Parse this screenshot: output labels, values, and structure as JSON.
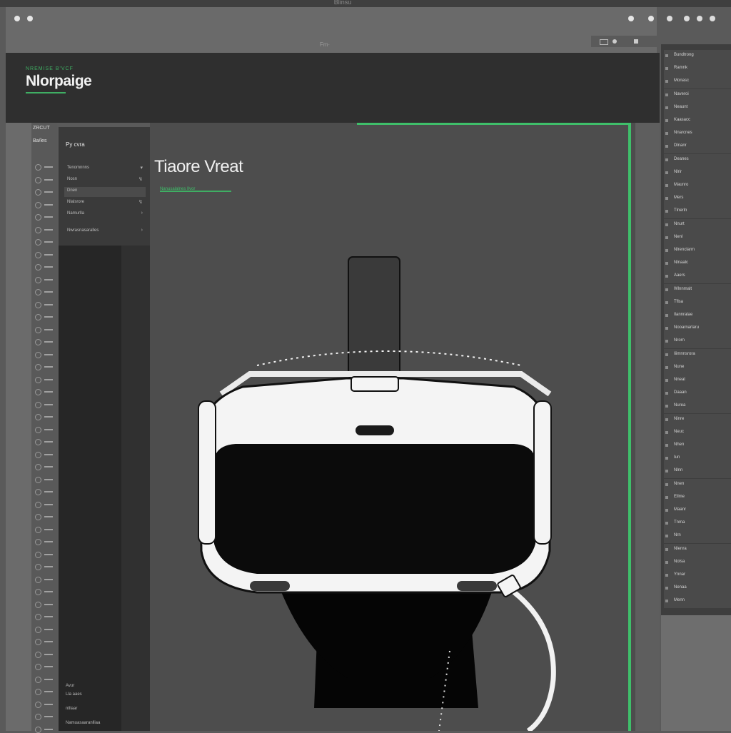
{
  "window": {
    "title": "Blinsu"
  },
  "toolbar": {
    "subtitle": "Fm·"
  },
  "app": {
    "brand_tag": "NREMISE B'VCF",
    "brand": "Nlorpaige"
  },
  "iconbar": {
    "header1": "ZRCUT",
    "header2": "Ba/les"
  },
  "sidebar": {
    "title": "Py cvra",
    "menu": [
      {
        "label": "Tenomnnns",
        "action": "▾",
        "selected": false
      },
      {
        "label": "Nosn",
        "action": "↯",
        "selected": false
      },
      {
        "label": "Dnen",
        "action": "",
        "selected": true
      },
      {
        "label": "Nlalsrore",
        "action": "↯",
        "selected": false
      },
      {
        "label": "Namurlla",
        "action": "›",
        "selected": false
      },
      {
        "label": "Nwrasnasaralles",
        "action": "›",
        "selected": false
      }
    ],
    "footer": [
      "Avur",
      "Lla aaes",
      "ntllaar",
      "Namuasaaranlliaa"
    ]
  },
  "main": {
    "title": "Tiaore Vreat",
    "subtitle": "Nanusalalnes Ilvor"
  },
  "rpanel": {
    "items": [
      "Bundtrong",
      "Ramnk",
      "Monasc",
      "Naveroi",
      "Neaunt",
      "Kaasacc",
      "Nnarcnes",
      "Dlnanr",
      "Deanes",
      "Nlrir",
      "Maunro",
      "Mers",
      "Tlnerln",
      "Nnurt",
      "Nenl",
      "Nlrenclarm",
      "Nlnaalc",
      "Aaers",
      "Wlnnmalt",
      "Tflsa",
      "Ilannralae",
      "Nooarnarlaru",
      "Nrorn",
      "Iiimnnsrora",
      "Nune",
      "Nneal",
      "Daaan",
      "Nurea",
      "Ninre",
      "Neuc",
      "Nhen",
      "Iun",
      "Nlnn",
      "Nnen",
      "Ellme",
      "Maanr",
      "Tnma",
      "Nrn",
      "Nlenra",
      "Nolsa",
      "Ynnar",
      "Nenaa",
      "Menn"
    ]
  },
  "colors": {
    "accent": "#3fbf6a",
    "panel": "#3e3e3e",
    "header": "#2f2f2f"
  }
}
